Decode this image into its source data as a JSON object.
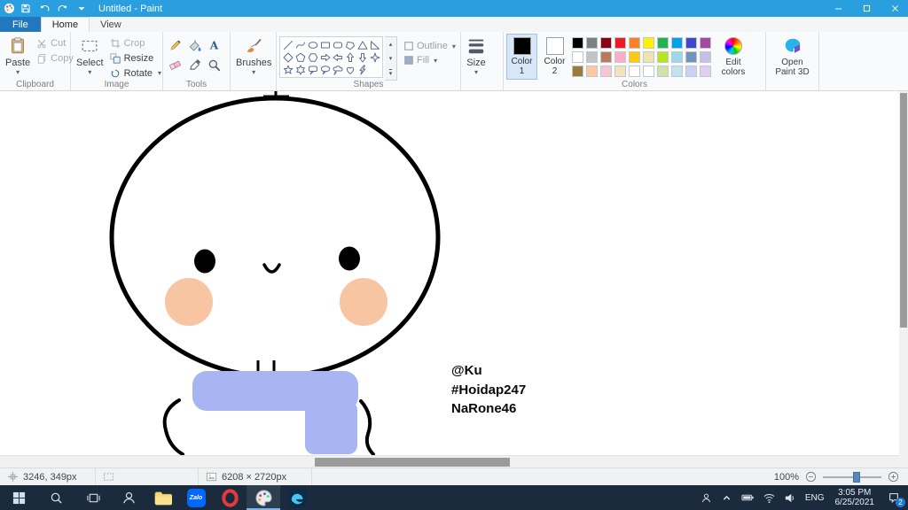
{
  "ui_colors": {
    "titlebar": "#2a9fe0",
    "file_tab": "#2377bd",
    "taskbar": "#1b2b3d",
    "taskbar_badge": "#1e78d7"
  },
  "titlebar": {
    "title": "Untitled - Paint"
  },
  "menu": {
    "file": "File",
    "home": "Home",
    "view": "View"
  },
  "ribbon": {
    "clipboard": {
      "group": "Clipboard",
      "paste": "Paste",
      "cut": "Cut",
      "copy": "Copy"
    },
    "image": {
      "group": "Image",
      "select": "Select",
      "crop": "Crop",
      "resize": "Resize",
      "rotate": "Rotate"
    },
    "tools": {
      "group": "Tools",
      "items": [
        "pencil",
        "fill-with-color",
        "text",
        "eraser",
        "color-picker",
        "magnifier"
      ]
    },
    "brushes": {
      "label": "Brushes"
    },
    "shapes": {
      "group": "Shapes",
      "outline": "Outline",
      "fill": "Fill",
      "items": [
        "line",
        "curve",
        "oval",
        "rectangle",
        "rounded-rectangle",
        "polygon",
        "triangle",
        "right-triangle",
        "diamond",
        "pentagon",
        "hexagon",
        "right-arrow",
        "left-arrow",
        "up-arrow",
        "down-arrow",
        "four-point-star",
        "five-point-star",
        "six-point-star",
        "rounded-callout",
        "oval-callout",
        "cloud-callout",
        "heart",
        "lightning"
      ]
    },
    "size": {
      "label": "Size"
    },
    "colors": {
      "group": "Colors",
      "color1_label": "Color 1",
      "color2_label": "Color 2",
      "edit_colors": "Edit colors",
      "color1_value": "#000000",
      "color2_value": "#ffffff",
      "palette": [
        "#000000",
        "#7f7f7f",
        "#880015",
        "#ed1c24",
        "#ff7f27",
        "#fff200",
        "#22b14c",
        "#00a2e8",
        "#3f48cc",
        "#a349a4",
        "#ffffff",
        "#c3c3c3",
        "#b97a57",
        "#ffaec9",
        "#ffc90e",
        "#efe4b0",
        "#b5e61d",
        "#99d9ea",
        "#7092be",
        "#c8bfe7",
        "#9c7a3c",
        "#ffc8a4",
        "#f6c6ce",
        "#f2e3c0",
        "#ffffff",
        "#ffffff",
        "#cfe3a6",
        "#bfe4ee",
        "#ccd0f4",
        "#dccff0"
      ]
    },
    "paint3d": {
      "label": "Open Paint 3D"
    }
  },
  "canvas": {
    "texts": {
      "line1": "@Ku",
      "line2": "#Hoidap247",
      "line3": "NaRone46"
    },
    "character": {
      "outline": "#000000",
      "cheeks": "#f8c5a3",
      "scarf": "#a9b4f2"
    }
  },
  "statusbar": {
    "cursor_position": "3246, 349px",
    "image_size": "6208 × 2720px",
    "zoom": "100%"
  },
  "taskbar": {
    "zalo": "Zalo",
    "language": "ENG",
    "time": "3:05 PM",
    "date": "6/25/2021",
    "notification_count": "2"
  }
}
